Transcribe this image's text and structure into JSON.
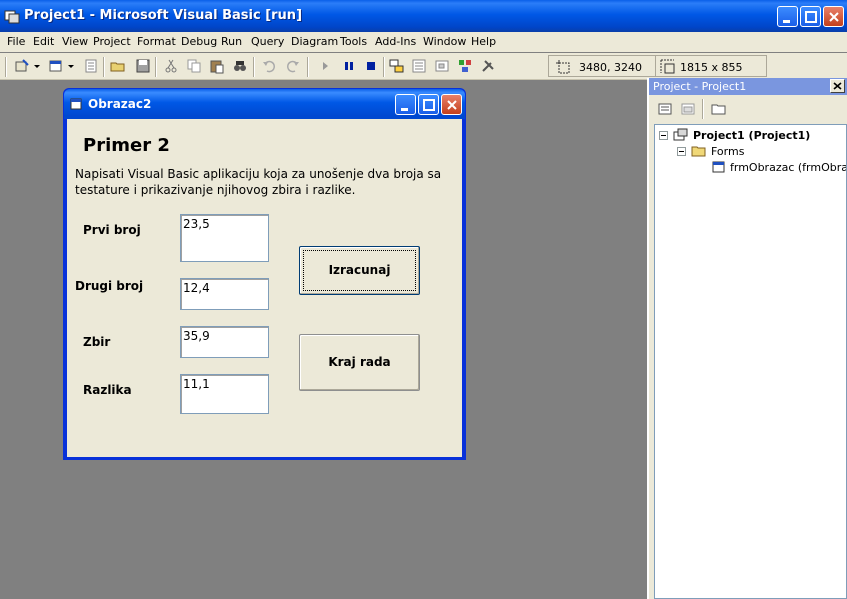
{
  "window": {
    "title": "Project1 - Microsoft Visual Basic [run]"
  },
  "menu": [
    "File",
    "Edit",
    "View",
    "Project",
    "Format",
    "Debug",
    "Run",
    "Query",
    "Diagram",
    "Tools",
    "Add-Ins",
    "Window",
    "Help"
  ],
  "toolbar": {
    "position": "3480, 3240",
    "size": "1815 x 855"
  },
  "form": {
    "title": "Obrazac2",
    "heading": "Primer 2",
    "description": "Napisati Visual Basic aplikaciju koja za unošenje dva broja sa testature i prikazivanje njihovog zbira i razlike.",
    "labels": {
      "first": "Prvi broj",
      "second": "Drugi broj",
      "sum": "Zbir",
      "diff": "Razlika"
    },
    "values": {
      "first": "23,5",
      "second": "12,4",
      "sum": "35,9",
      "diff": "11,1"
    },
    "buttons": {
      "calc": "Izracunaj",
      "exit": "Kraj rada"
    }
  },
  "project": {
    "title": "Project - Project1",
    "root": "Project1 (Project1)",
    "folder": "Forms",
    "form_item": "frmObrazac (frmObrazac)"
  },
  "colors": {
    "titlebar": "#0058e6",
    "face": "#ece9d8",
    "workspace": "#808080"
  }
}
